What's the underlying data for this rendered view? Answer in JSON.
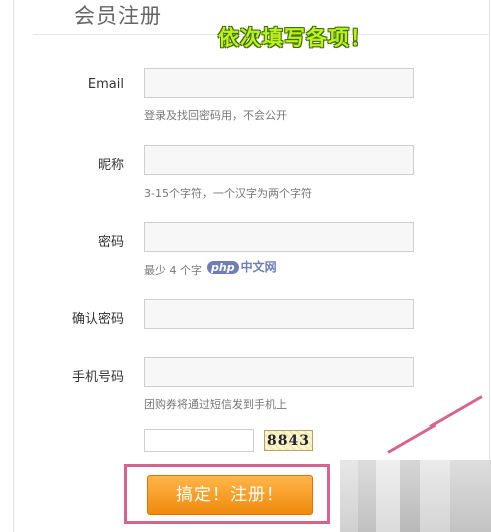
{
  "header": {
    "title": "会员注册",
    "callout": "依次填写各项！"
  },
  "form": {
    "fields": [
      {
        "label": "Email",
        "value": "",
        "hint": "登录及找回密码用，不会公开"
      },
      {
        "label": "昵称",
        "value": "",
        "hint": "3-15个字符，一个汉字为两个字符"
      },
      {
        "label": "密码",
        "value": "",
        "hint": "最少 4 个字"
      },
      {
        "label": "确认密码",
        "value": "",
        "hint": ""
      },
      {
        "label": "手机号码",
        "value": "",
        "hint": "团购券将通过短信发到手机上"
      }
    ],
    "captcha": {
      "value": "",
      "image_text": "8843"
    },
    "submit_label": "搞定！注册！"
  },
  "watermark": {
    "logo": "php",
    "text": "中文网"
  },
  "colors": {
    "accent": "#f08a0c",
    "highlight": "#d8638f",
    "callout": "#b9f21d"
  }
}
